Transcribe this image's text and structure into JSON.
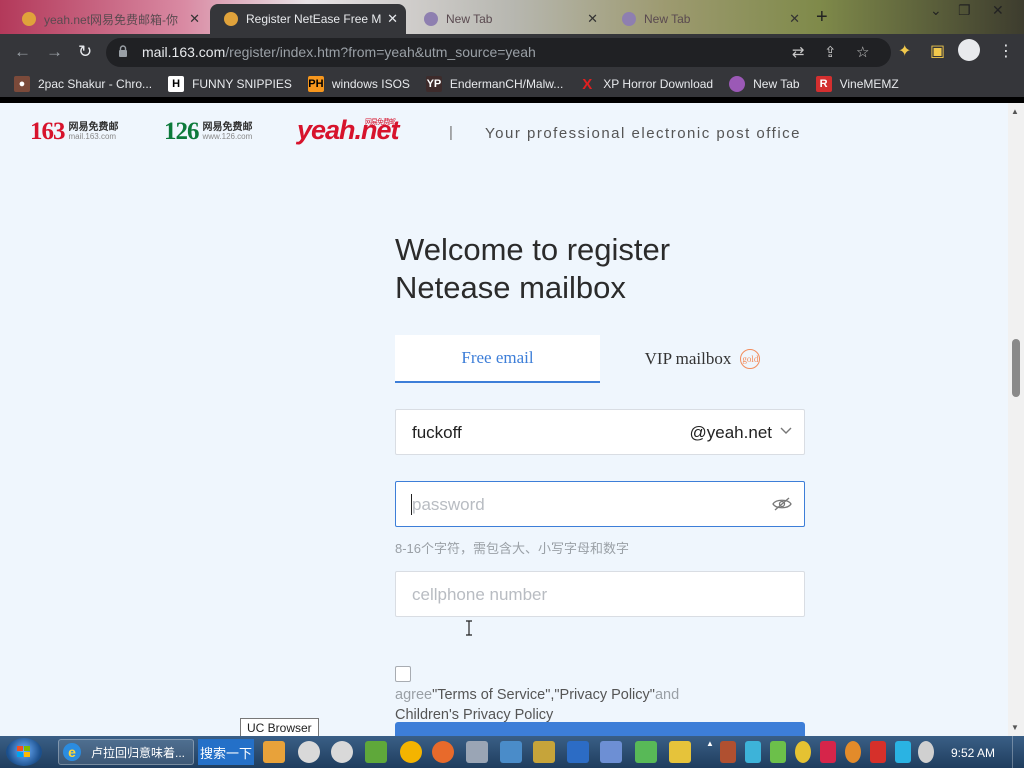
{
  "browser": {
    "tabs": [
      {
        "label": "yeah.net网易免费邮箱-你",
        "active": false
      },
      {
        "label": "Register NetEase Free M",
        "active": true
      },
      {
        "label": "New Tab",
        "active": false
      },
      {
        "label": "New Tab",
        "active": false
      }
    ],
    "url_host": "mail.163.com",
    "url_path": "/register/index.htm?from=yeah&utm_source=yeah",
    "bookmarks": [
      {
        "label": "2pac Shakur - Chro...",
        "icon": "person-icon",
        "color": "#c0392b"
      },
      {
        "label": "FUNNY SNIPPIES",
        "icon": "H",
        "color": "#ffffff"
      },
      {
        "label": "windows ISOS",
        "icon": "PH",
        "color": "#f7971d"
      },
      {
        "label": "EndermanCH/Malw...",
        "icon": "YP",
        "color": "#3d2b2b"
      },
      {
        "label": "XP Horror Download",
        "icon": "X",
        "color": "#e02020"
      },
      {
        "label": "New Tab",
        "icon": "chrome-icon",
        "color": "#9b59b6"
      },
      {
        "label": "VineMEMZ",
        "icon": "R",
        "color": "#d32f2f"
      }
    ]
  },
  "page": {
    "logo_163": {
      "num": "163",
      "cn": "网易免费邮",
      "domain": "mail.163.com"
    },
    "logo_126": {
      "num": "126",
      "cn": "网易免费邮",
      "domain": "www.126.com"
    },
    "logo_yeah": {
      "text": "yeah",
      "suffix": ".net",
      "tag": "网易免费邮"
    },
    "divider": "|",
    "slogan": "Your professional electronic post office",
    "welcome_line1": "Welcome to register",
    "welcome_line2": "Netease mailbox",
    "tab_free": "Free email",
    "tab_vip": "VIP mailbox",
    "tab_vip_badge": "gold",
    "username_value": "fuckoff",
    "domain_value": "@yeah.net",
    "password_placeholder": "password",
    "password_hint": "8-16个字符，需包含大、小写字母和数字",
    "phone_placeholder": "cellphone number",
    "agree_prefix": "agree",
    "terms_link": "\"Terms of Service\"",
    "comma": ",",
    "privacy_link": "\"Privacy Policy\"",
    "and_text": "and",
    "children_link": "Children's Privacy Policy"
  },
  "tooltip": "UC Browser",
  "taskbar": {
    "ie_task_label": "卢拉回归意味着...",
    "search_label": "搜索一下",
    "clock": "9:52 AM"
  },
  "colors": {
    "accent": "#3d7ed8",
    "brand_red": "#d7132c",
    "brand_green": "#0c7a3a",
    "page_bg": "#eff6fd"
  }
}
